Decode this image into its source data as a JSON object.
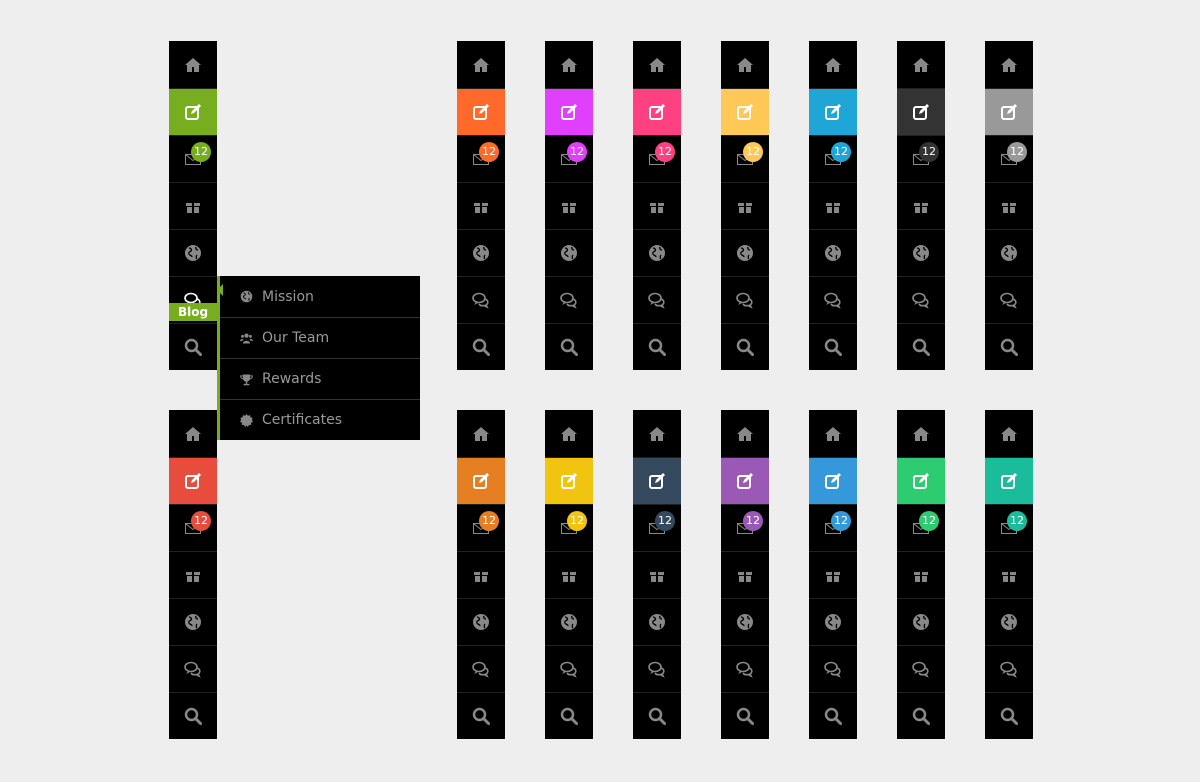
{
  "menu_icons": [
    "home-icon",
    "edit-icon",
    "mail-icon",
    "gift-icon",
    "globe-icon",
    "chat-icon",
    "search-icon"
  ],
  "badge_count": "12",
  "tooltip": "Blog",
  "columns": [
    {
      "row": "top",
      "accent": "#76ae1f",
      "variant": "green"
    },
    {
      "row": "top",
      "accent": "#ff6a2b",
      "variant": "orange"
    },
    {
      "row": "top",
      "accent": "#e040fb",
      "variant": "magenta"
    },
    {
      "row": "top",
      "accent": "#ff4081",
      "variant": "pink"
    },
    {
      "row": "top",
      "accent": "#ffc857",
      "variant": "yellow"
    },
    {
      "row": "top",
      "accent": "#1fa5d6",
      "variant": "blue"
    },
    {
      "row": "top",
      "accent": "#333333",
      "variant": "dark"
    },
    {
      "row": "top",
      "accent": "#999999",
      "variant": "gray"
    },
    {
      "row": "bottom",
      "accent": "#e74c3c",
      "variant": "red"
    },
    {
      "row": "bottom",
      "accent": "#e67e22",
      "variant": "carrot"
    },
    {
      "row": "bottom",
      "accent": "#f1c40f",
      "variant": "sunflower"
    },
    {
      "row": "bottom",
      "accent": "#34495e",
      "variant": "navy"
    },
    {
      "row": "bottom",
      "accent": "#9b59b6",
      "variant": "purple"
    },
    {
      "row": "bottom",
      "accent": "#3498db",
      "variant": "sky"
    },
    {
      "row": "bottom",
      "accent": "#2ecc71",
      "variant": "emerald"
    },
    {
      "row": "bottom",
      "accent": "#1abc9c",
      "variant": "teal"
    }
  ],
  "dropdown": {
    "items": [
      {
        "label": "Mission",
        "icon": "globe-icon"
      },
      {
        "label": "Our Team",
        "icon": "users-icon"
      },
      {
        "label": "Rewards",
        "icon": "trophy-icon"
      },
      {
        "label": "Certificates",
        "icon": "certificate-icon"
      }
    ]
  }
}
